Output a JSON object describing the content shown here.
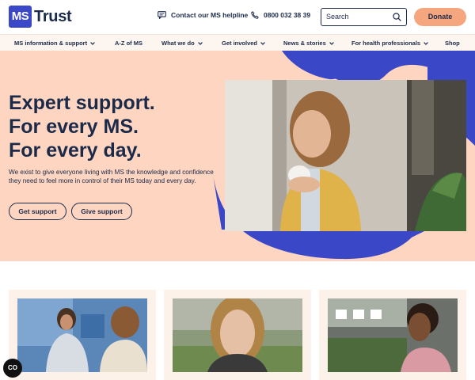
{
  "header": {
    "logo_mark": "MS",
    "logo_word": "Trust",
    "helpline_label": "Contact our MS helpline",
    "phone_number": "0800 032 38 39",
    "search_placeholder": "Search",
    "donate_label": "Donate"
  },
  "nav": {
    "items": [
      {
        "label": "MS information & support",
        "has_dropdown": true
      },
      {
        "label": "A-Z of MS",
        "has_dropdown": false
      },
      {
        "label": "What we do",
        "has_dropdown": true
      },
      {
        "label": "Get involved",
        "has_dropdown": true
      },
      {
        "label": "News & stories",
        "has_dropdown": true
      },
      {
        "label": "For health professionals",
        "has_dropdown": true
      },
      {
        "label": "Shop",
        "has_dropdown": false
      }
    ]
  },
  "hero": {
    "title_line1": "Expert support.",
    "title_line2": "For every MS.",
    "title_line3": "For every day.",
    "description": "We exist to give everyone living with MS the knowledge and confidence they need to feel more in control of their MS today and every day.",
    "button_primary": "Get support",
    "button_secondary": "Give support"
  },
  "cookie_badge": "CO",
  "colors": {
    "brand_blue": "#3a48c8",
    "navy": "#1c2a4a",
    "peach": "#fdd5c0",
    "donate_orange": "#f6a67e",
    "nav_bg": "#fdf5ef",
    "card_bg": "#fdf2ea"
  },
  "icons": {
    "helpline": "chat-bubble-icon",
    "phone": "phone-icon",
    "search": "search-icon",
    "chevron": "chevron-down-icon"
  }
}
